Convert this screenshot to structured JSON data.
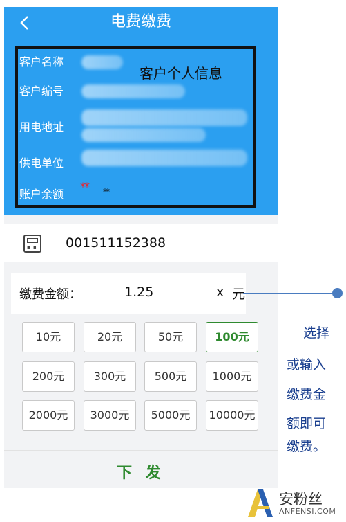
{
  "header": {
    "back_icon": "chevron-left-icon",
    "title": "电费缴费"
  },
  "customer_info": {
    "box_title": "客户个人信息",
    "fields": [
      {
        "label": "客户名称"
      },
      {
        "label": "客户编号"
      },
      {
        "label": "用电地址"
      },
      {
        "label": "供电单位"
      },
      {
        "label": "账户余额"
      }
    ],
    "balance_mask_red": "**",
    "balance_mask_black": "**"
  },
  "meter": {
    "icon": "meter-icon",
    "number": "001511152388"
  },
  "amount": {
    "label": "缴费金额：",
    "value": "1.25",
    "clear": "x",
    "unit": "元"
  },
  "presets": [
    {
      "label": "10元"
    },
    {
      "label": "20元"
    },
    {
      "label": "50元"
    },
    {
      "label": "100元",
      "selected": true
    },
    {
      "label": "200元"
    },
    {
      "label": "300元"
    },
    {
      "label": "500元"
    },
    {
      "label": "1000元"
    },
    {
      "label": "2000元"
    },
    {
      "label": "3000元"
    },
    {
      "label": "5000元"
    },
    {
      "label": "10000元"
    }
  ],
  "submit_label": "下 发",
  "annotation": [
    "选择",
    "或输入",
    "缴费金",
    "额即可",
    "缴费。"
  ],
  "watermark": {
    "cn": "安粉丝",
    "en": "ANFENSI.COM"
  },
  "colors": {
    "header_blue": "#2b9ff0",
    "accent_green": "#2f8a2f",
    "annotation_blue": "#1a3f8f"
  }
}
